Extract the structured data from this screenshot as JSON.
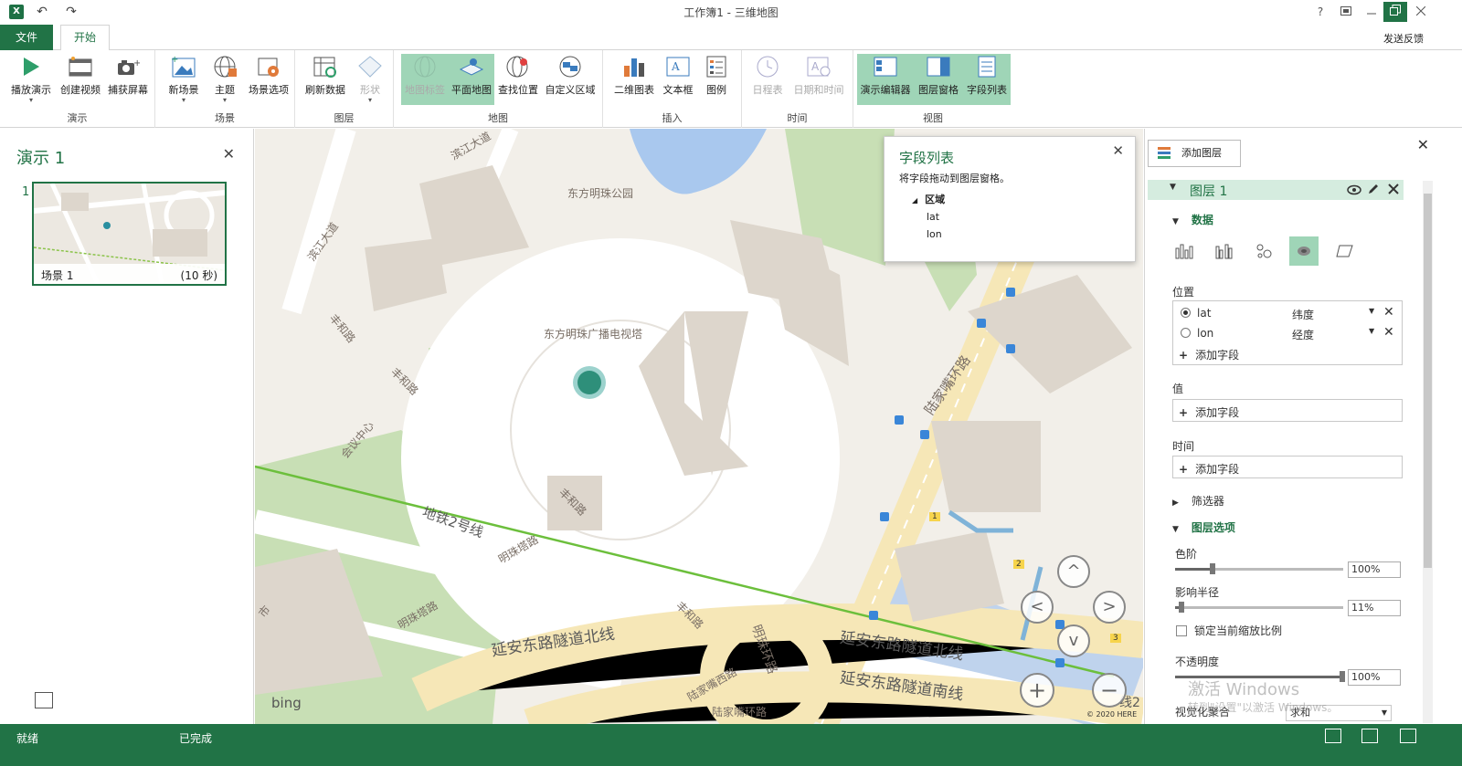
{
  "titlebar": {
    "title": "工作簿1 - 三维地图",
    "undo": "↶",
    "redo": "↷",
    "help": "?",
    "excel_logo": "X"
  },
  "tabs": {
    "file": "文件",
    "home": "开始",
    "feedback": "发送反馈"
  },
  "ribbon": {
    "groups": {
      "tour": "演示",
      "scene": "场景",
      "layer": "图层",
      "map": "地图",
      "insert": "插入",
      "time": "时间",
      "view": "视图"
    },
    "buttons": {
      "play_tour": "播放演示",
      "create_video": "创建视频",
      "capture_screen": "捕获屏幕",
      "new_scene": "新场景",
      "themes": "主题",
      "scene_options": "场景选项",
      "refresh_data": "刷新数据",
      "shapes": "形状",
      "map_labels": "地图标签",
      "flat_map": "平面地图",
      "find_location": "查找位置",
      "custom_regions": "自定义区域",
      "chart_2d": "二维图表",
      "text_box": "文本框",
      "legend": "图例",
      "timeline": "日程表",
      "date_time": "日期和时间",
      "tour_editor": "演示编辑器",
      "layer_pane": "图层窗格",
      "field_list": "字段列表"
    }
  },
  "left_pane": {
    "title": "演示 1",
    "close": "✕",
    "scene": {
      "number": "1",
      "name": "场景 1",
      "duration": "(10 秒)"
    }
  },
  "map": {
    "labels": {
      "park": "东方明珠公园",
      "tower": "东方明珠广播电视塔",
      "binjiang1": "滨江大道",
      "binjiang2": "滨江大道",
      "fenghe1": "丰和路",
      "fenghe2": "丰和路",
      "fenghe3": "丰和路",
      "fenghe4": "丰和路",
      "huiyi": "会议中心",
      "metro": "地铁2号线",
      "mingzhuta1": "明珠塔路",
      "mingzhuta2": "明珠塔路",
      "mingzhu_ring": "明珠环路",
      "lujiazui_ring": "陆家嘴环路",
      "lujiazui_xi": "陆家嘴西路",
      "lujiazui_ring2": "陆家嘴环路",
      "yanan_north": "延安东路隧道北线",
      "yanan_north2": "延安东路隧道北线",
      "yanan_south": "延安东路隧道南线",
      "shi": "市",
      "line2": "线2",
      "badge1": "1",
      "badge2": "2",
      "badge3": "3"
    },
    "bing": "bing",
    "copyright": "© 2020 HERE",
    "nav": {
      "up": "^",
      "left": "<",
      "right": ">",
      "down": "v",
      "zoom_in": "+",
      "zoom_out": "−"
    }
  },
  "field_list_popup": {
    "title": "字段列表",
    "close": "✕",
    "description": "将字段拖动到图层窗格。",
    "root": "区域",
    "fields": [
      "lat",
      "lon"
    ]
  },
  "right_pane": {
    "close": "✕",
    "add_layer": "添加图层",
    "layer_name": "图层 1",
    "data_section": "数据",
    "location_label": "位置",
    "location_fields": [
      {
        "name": "lat",
        "type": "纬度"
      },
      {
        "name": "lon",
        "type": "经度"
      }
    ],
    "add_field": "添加字段",
    "value_label": "值",
    "time_label": "时间",
    "filters": "筛选器",
    "layer_options": "图层选项",
    "color_scale_label": "色阶",
    "color_scale_value": "100%",
    "radius_label": "影响半径",
    "radius_value": "11%",
    "lock_zoom_label": "锁定当前缩放比例",
    "opacity_label": "不透明度",
    "opacity_value": "100%",
    "aggregation_label": "视觉化聚合",
    "aggregation_value": "求和"
  },
  "watermark": {
    "line1": "激活 Windows",
    "line2": "转到\"设置\"以激活 Windows。"
  },
  "status": {
    "ready": "就绪",
    "done": "已完成"
  }
}
